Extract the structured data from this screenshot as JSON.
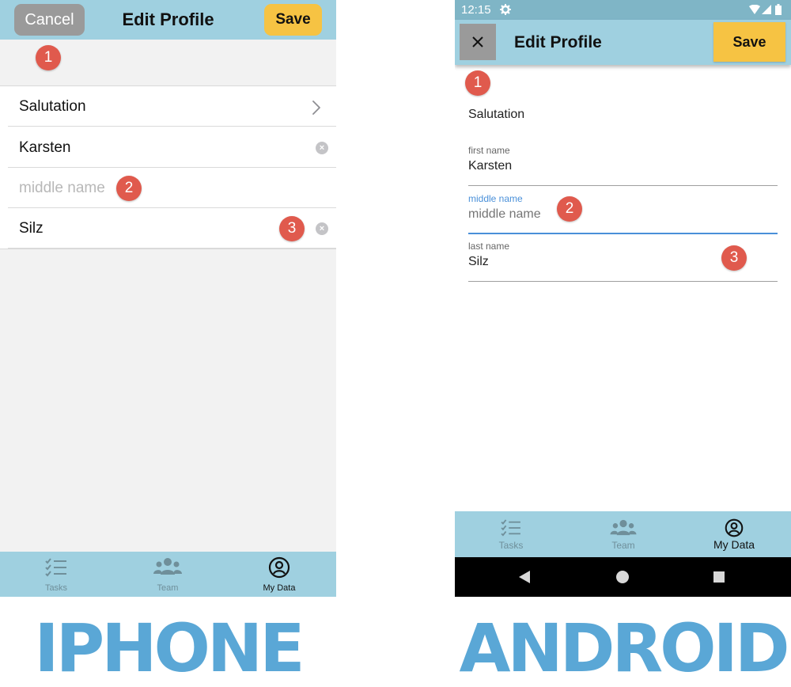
{
  "colors": {
    "header_bg": "#9fd0e0",
    "save_bg": "#f6c343",
    "cancel_bg": "#9a9a9a",
    "badge_bg": "#e05a4d",
    "caption": "#5aa7d6",
    "android_active": "#4a90d9"
  },
  "iphone": {
    "header": {
      "cancel_label": "Cancel",
      "title": "Edit Profile",
      "save_label": "Save"
    },
    "rows": {
      "salutation": "Salutation",
      "first_name_value": "Karsten",
      "middle_name_placeholder": "middle name",
      "last_name_value": "Silz"
    },
    "tabs": [
      {
        "label": "Tasks",
        "icon": "checklist-icon",
        "active": false
      },
      {
        "label": "Team",
        "icon": "team-icon",
        "active": false
      },
      {
        "label": "My Data",
        "icon": "user-circle-icon",
        "active": true
      }
    ],
    "caption": "IPHONE"
  },
  "android": {
    "status_bar": {
      "time": "12:15",
      "icons": [
        "gear-icon",
        "wifi-icon",
        "signal-icon",
        "battery-icon"
      ]
    },
    "header": {
      "close_icon": "close-icon",
      "title": "Edit Profile",
      "save_label": "Save"
    },
    "salutation": "Salutation",
    "fields": {
      "first_name_label": "first name",
      "first_name_value": "Karsten",
      "middle_name_label": "middle name",
      "middle_name_placeholder": "middle name",
      "last_name_label": "last name",
      "last_name_value": "Silz"
    },
    "tabs": [
      {
        "label": "Tasks",
        "icon": "checklist-icon",
        "active": false
      },
      {
        "label": "Team",
        "icon": "team-icon",
        "active": false
      },
      {
        "label": "My Data",
        "icon": "user-circle-icon",
        "active": true
      }
    ],
    "nav_bar": [
      "back-icon",
      "home-icon",
      "recents-icon"
    ],
    "caption": "ANDROID"
  },
  "badges": [
    "1",
    "2",
    "3"
  ]
}
